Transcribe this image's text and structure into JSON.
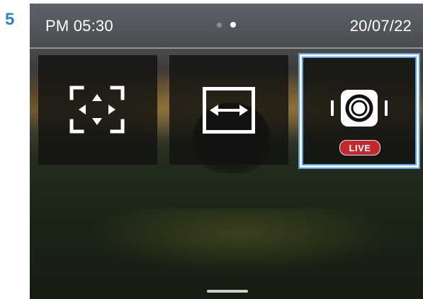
{
  "step": {
    "number": "5"
  },
  "status_bar": {
    "time": "PM 05:30",
    "date": "20/07/22",
    "page_count": 2,
    "active_page_index": 1
  },
  "modes": [
    {
      "name": "frame-adjust",
      "icon": "frame-arrows-icon",
      "selected": false
    },
    {
      "name": "horizontal-fit",
      "icon": "double-arrow-icon",
      "selected": false
    },
    {
      "name": "live-camera",
      "icon": "camera-live-icon",
      "selected": true,
      "badge": "LIVE"
    }
  ],
  "colors": {
    "step_number": "#2a86c8",
    "selection_border": "#5aa0e6",
    "live_badge": "#c4282e"
  }
}
